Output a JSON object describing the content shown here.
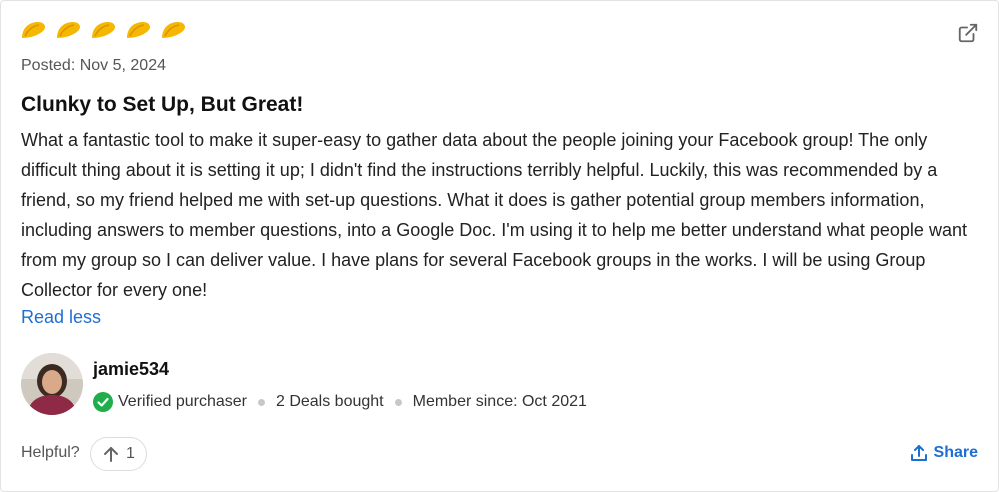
{
  "review": {
    "rating": 5,
    "posted": "Posted: Nov 5, 2024",
    "title": "Clunky to Set Up, But Great!",
    "body": "What a fantastic tool to make it super-easy to gather data about the people joining your Facebook group! The only difficult thing about it is setting it up; I didn't find the instructions terribly helpful. Luckily, this was recommended by a friend, so my friend helped me with set-up questions. What it does is gather potential group members information, including answers to member questions, into a Google Doc. I'm using it to help me better understand what people want from my group so I can deliver value. I have plans for several Facebook groups in the works. I will be using Group Collector for every one!",
    "read_less": "Read less"
  },
  "reviewer": {
    "username": "jamie534",
    "verified": "Verified purchaser",
    "deals": "2 Deals bought",
    "member_since": "Member since: Oct 2021"
  },
  "footer": {
    "helpful_label": "Helpful?",
    "upvotes": "1",
    "share_label": "Share"
  },
  "colors": {
    "taco": "#f5b700",
    "link": "#1d6fd1",
    "verified": "#1fae4b"
  },
  "icons": {
    "rating": "taco-icon",
    "external": "external-link-icon",
    "verified": "check-circle-icon",
    "upvote": "arrow-up-icon",
    "share": "share-icon"
  }
}
